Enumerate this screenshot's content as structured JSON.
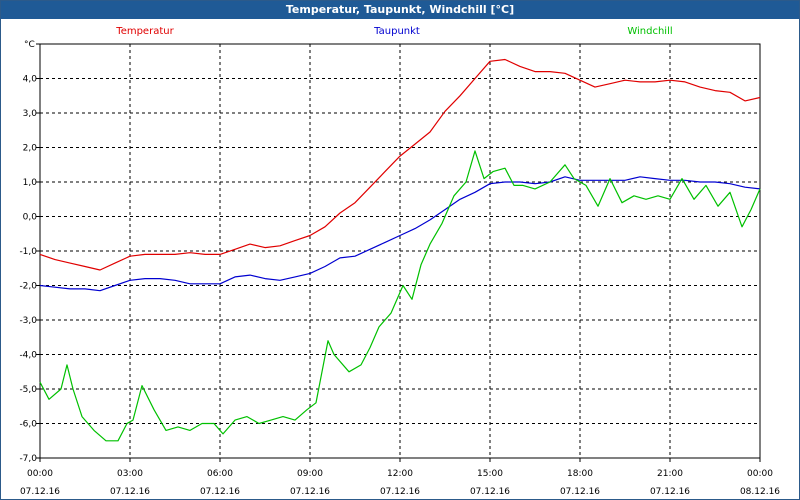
{
  "window": {
    "title": "Temperatur, Taupunkt, Windchill [°C]"
  },
  "chart_data": {
    "type": "line",
    "title": "Temperatur, Taupunkt, Windchill [°C]",
    "ylabel": "°C",
    "xlabel": "",
    "ylim": [
      -7.0,
      5.0
    ],
    "yticks": [
      "5,0",
      "4,0",
      "3,0",
      "2,0",
      "1,0",
      "0,0",
      "-1,0",
      "-2,0",
      "-3,0",
      "-4,0",
      "-5,0",
      "-6,0",
      "-7,0"
    ],
    "xlim_hours": [
      0,
      24
    ],
    "xticks": [
      {
        "time": "00:00",
        "date": "07.12.16"
      },
      {
        "time": "03:00",
        "date": "07.12.16"
      },
      {
        "time": "06:00",
        "date": "07.12.16"
      },
      {
        "time": "09:00",
        "date": "07.12.16"
      },
      {
        "time": "12:00",
        "date": "07.12.16"
      },
      {
        "time": "15:00",
        "date": "07.12.16"
      },
      {
        "time": "18:00",
        "date": "07.12.16"
      },
      {
        "time": "21:00",
        "date": "07.12.16"
      },
      {
        "time": "00:00",
        "date": "08.12.16"
      }
    ],
    "grid": true,
    "legend_position": "top",
    "series": [
      {
        "name": "Temperatur",
        "color": "#e00000",
        "x": [
          0,
          0.5,
          1,
          1.5,
          2,
          2.5,
          3,
          3.5,
          4,
          4.5,
          5,
          5.5,
          6,
          6.5,
          7,
          7.5,
          8,
          8.5,
          9,
          9.5,
          10,
          10.5,
          11,
          11.5,
          12,
          12.5,
          13,
          13.5,
          14,
          14.5,
          15,
          15.5,
          16,
          16.5,
          17,
          17.5,
          18,
          18.5,
          19,
          19.5,
          20,
          20.5,
          21,
          21.5,
          22,
          22.5,
          23,
          23.5,
          24
        ],
        "y": [
          -1.1,
          -1.25,
          -1.35,
          -1.45,
          -1.55,
          -1.35,
          -1.15,
          -1.1,
          -1.1,
          -1.1,
          -1.05,
          -1.1,
          -1.1,
          -0.95,
          -0.8,
          -0.9,
          -0.85,
          -0.7,
          -0.55,
          -0.3,
          0.1,
          0.4,
          0.85,
          1.3,
          1.75,
          2.1,
          2.45,
          3.05,
          3.5,
          4.0,
          4.5,
          4.55,
          4.35,
          4.2,
          4.2,
          4.15,
          3.95,
          3.75,
          3.85,
          3.95,
          3.9,
          3.9,
          3.95,
          3.9,
          3.75,
          3.65,
          3.6,
          3.35,
          3.45
        ]
      },
      {
        "name": "Taupunkt",
        "color": "#0000d0",
        "x": [
          0,
          0.5,
          1,
          1.5,
          2,
          2.5,
          3,
          3.5,
          4,
          4.5,
          5,
          5.5,
          6,
          6.5,
          7,
          7.5,
          8,
          8.5,
          9,
          9.5,
          10,
          10.5,
          11,
          11.5,
          12,
          12.5,
          13,
          13.5,
          14,
          14.5,
          15,
          15.5,
          16,
          16.5,
          17,
          17.5,
          18,
          18.5,
          19,
          19.5,
          20,
          20.5,
          21,
          21.5,
          22,
          22.5,
          23,
          23.5,
          24
        ],
        "y": [
          -2.0,
          -2.05,
          -2.1,
          -2.1,
          -2.15,
          -2.0,
          -1.85,
          -1.8,
          -1.8,
          -1.85,
          -1.95,
          -1.95,
          -1.95,
          -1.75,
          -1.7,
          -1.8,
          -1.85,
          -1.75,
          -1.65,
          -1.45,
          -1.2,
          -1.15,
          -0.95,
          -0.75,
          -0.55,
          -0.35,
          -0.1,
          0.2,
          0.5,
          0.7,
          0.95,
          1.0,
          1.0,
          0.95,
          1.0,
          1.15,
          1.05,
          1.05,
          1.05,
          1.05,
          1.15,
          1.1,
          1.05,
          1.05,
          1.0,
          1.0,
          0.95,
          0.85,
          0.8
        ]
      },
      {
        "name": "Windchill",
        "color": "#00c000",
        "x": [
          0,
          0.3,
          0.7,
          0.9,
          1.1,
          1.4,
          1.8,
          2.2,
          2.6,
          2.9,
          3.1,
          3.4,
          3.8,
          4.2,
          4.6,
          5.0,
          5.4,
          5.8,
          6.1,
          6.5,
          6.9,
          7.3,
          7.7,
          8.1,
          8.5,
          8.9,
          9.2,
          9.6,
          9.8,
          10.3,
          10.7,
          11.0,
          11.3,
          11.7,
          12.1,
          12.4,
          12.7,
          13.0,
          13.4,
          13.8,
          14.2,
          14.5,
          14.8,
          15.1,
          15.5,
          15.8,
          16.1,
          16.5,
          17.0,
          17.5,
          17.8,
          18.2,
          18.6,
          19.0,
          19.4,
          19.8,
          20.2,
          20.6,
          21.0,
          21.4,
          21.8,
          22.2,
          22.6,
          23.0,
          23.4,
          23.7,
          24.0
        ],
        "y": [
          -4.8,
          -5.3,
          -5.0,
          -4.3,
          -5.0,
          -5.8,
          -6.2,
          -6.5,
          -6.5,
          -6.0,
          -5.9,
          -4.9,
          -5.6,
          -6.2,
          -6.1,
          -6.2,
          -6.0,
          -6.0,
          -6.3,
          -5.9,
          -5.8,
          -6.0,
          -5.9,
          -5.8,
          -5.9,
          -5.6,
          -5.4,
          -3.6,
          -4.0,
          -4.5,
          -4.3,
          -3.8,
          -3.2,
          -2.8,
          -2.0,
          -2.4,
          -1.4,
          -0.8,
          -0.2,
          0.6,
          1.0,
          1.9,
          1.1,
          1.3,
          1.4,
          0.9,
          0.9,
          0.8,
          1.0,
          1.5,
          1.1,
          0.9,
          0.3,
          1.1,
          0.4,
          0.6,
          0.5,
          0.6,
          0.5,
          1.1,
          0.5,
          0.9,
          0.3,
          0.7,
          -0.3,
          0.2,
          0.8
        ]
      }
    ]
  }
}
